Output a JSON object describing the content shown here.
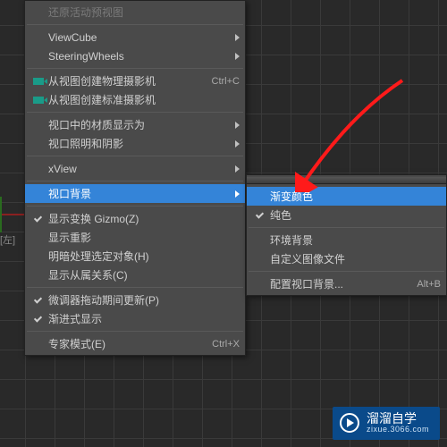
{
  "axis_label": "[左]",
  "main_menu": {
    "restore": "还原活动预视图",
    "viewcube": "ViewCube",
    "steering": "SteeringWheels",
    "create_phys_cam": "从视图创建物理摄影机",
    "create_phys_cam_sc": "Ctrl+C",
    "create_std_cam": "从视图创建标准摄影机",
    "material_display": "视口中的材质显示为",
    "lighting_shadow": "视口照明和阴影",
    "xview": "xView",
    "viewport_bg": "视口背景",
    "show_transform": "显示变换 Gizmo(Z)",
    "show_ghosting": "显示重影",
    "shade_selected": "明暗处理选定对象(H)",
    "show_dependencies": "显示从属关系(C)",
    "update_during_spinner": "微调器拖动期间更新(P)",
    "progressive_display": "渐进式显示",
    "expert_mode": "专家模式(E)",
    "expert_mode_sc": "Ctrl+X"
  },
  "sub_menu": {
    "gradient": "渐变颜色",
    "solid": "纯色",
    "environment": "环境背景",
    "custom_image": "自定义图像文件",
    "configure": "配置视口背景...",
    "configure_sc": "Alt+B"
  },
  "watermark": {
    "title": "溜溜自学",
    "sub": "zixue.3066.com"
  }
}
